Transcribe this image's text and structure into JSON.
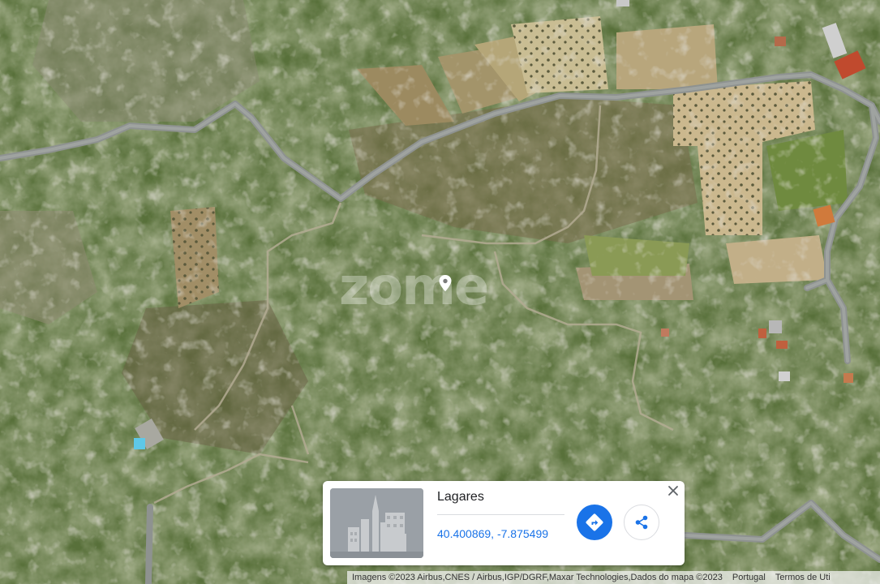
{
  "map": {
    "type": "satellite",
    "colors": {
      "vegetation": "#4f6a2c",
      "road": "#8e9290",
      "rock": "#b6b2a4",
      "field": "#c7b78d"
    }
  },
  "watermark": {
    "text": "zome"
  },
  "pin": {
    "icon": "location-pin-icon"
  },
  "info_card": {
    "title": "Lagares",
    "coordinates": "40.400869, -7.875499",
    "directions_icon": "directions-icon",
    "share_icon": "share-icon",
    "close_icon": "close-icon",
    "accent_color": "#1a73e8"
  },
  "attribution": {
    "imagery": "Imagens ©2023 Airbus,CNES / Airbus,IGP/DGRF,Maxar Technologies,Dados do mapa ©2023",
    "region": "Portugal",
    "terms": "Termos de Uti"
  }
}
